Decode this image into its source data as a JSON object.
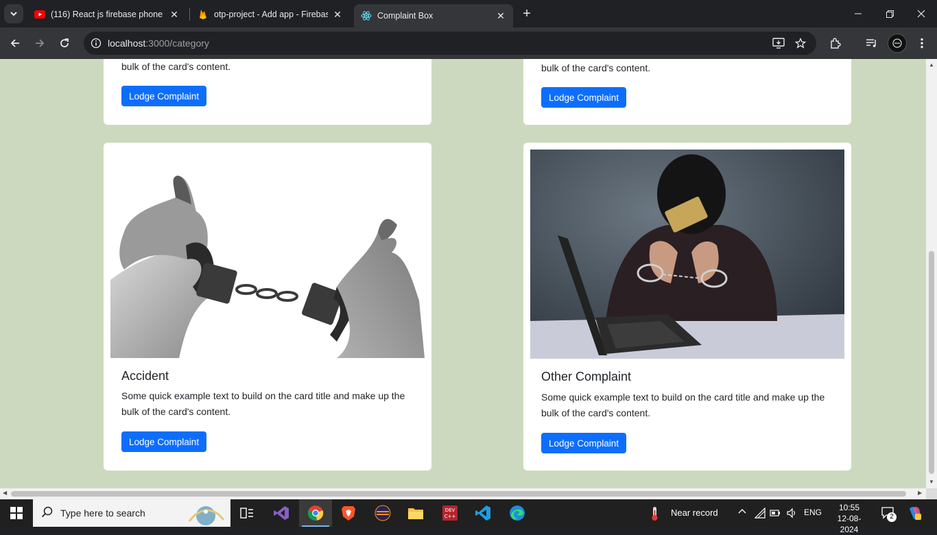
{
  "browser": {
    "tabs": [
      {
        "title": "(116) React js firebase phone au",
        "favicon": "youtube-icon"
      },
      {
        "title": "otp-project - Add app - Firebas",
        "favicon": "firebase-icon"
      },
      {
        "title": "Complaint Box",
        "favicon": "react-icon",
        "active": true
      }
    ],
    "new_tab_label": "+",
    "url_host": "localhost",
    "url_path": ":3000/category"
  },
  "page": {
    "cards": [
      {
        "title": "",
        "text_visible": "bulk of the card's content.",
        "button": "Lodge Complaint"
      },
      {
        "title": "",
        "text_visible": "bulk of the card's content.",
        "button": "Lodge Complaint"
      },
      {
        "title": "Accident",
        "text": "Some quick example text to build on the card title and make up the bulk of the card's content.",
        "button": "Lodge Complaint",
        "image": "handcuffs-photo"
      },
      {
        "title": "Other Complaint",
        "text": "Some quick example text to build on the card title and make up the bulk of the card's content.",
        "button": "Lodge Complaint",
        "image": "masked-person-laptop-photo"
      }
    ]
  },
  "taskbar": {
    "search_placeholder": "Type here to search",
    "weather": "Near record",
    "language": "ENG",
    "time": "10:55",
    "date": "12-08-2024",
    "notifications": "2",
    "apps": [
      "task-view-icon",
      "visual-studio-icon",
      "chrome-icon",
      "brave-icon",
      "eclipse-icon",
      "file-explorer-icon",
      "dev-cpp-icon",
      "vscode-icon",
      "edge-icon"
    ],
    "dev_cpp_label": "DEV C++"
  },
  "colors": {
    "page_bg": "#cdd9bf",
    "button": "#0d6efd",
    "browser_dark": "#202124",
    "toolbar": "#35363a"
  }
}
